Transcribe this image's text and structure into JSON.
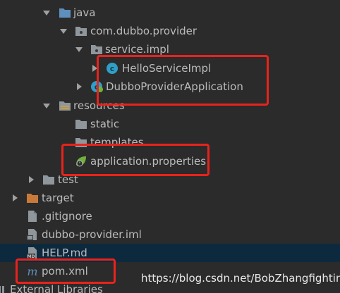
{
  "colors": {
    "background": "#2b2b2b",
    "selected_row": "#0d293e",
    "text": "#bbbbbb",
    "folder_blue": "#5f8fbd",
    "folder_gray": "#8f969c",
    "folder_orange": "#c97a3a",
    "annotation_red": "#e8231c",
    "class_cyan": "#2f9fc8",
    "spring_green": "#6fb23a"
  },
  "tree": {
    "java": "java",
    "package_provider": "com.dubbo.provider",
    "package_service_impl": "service.impl",
    "class_hello": "HelloServiceImpl",
    "class_app": "DubboProviderApplication",
    "folder_resources": "resources",
    "folder_static": "static",
    "folder_templates": "templates",
    "file_app_props": "application.properties",
    "folder_test": "test",
    "folder_target": "target",
    "file_gitignore": ".gitignore",
    "file_iml": "dubbo-provider.iml",
    "file_help": "HELP.md",
    "file_pom": "pom.xml",
    "external_libraries": "External Libraries"
  },
  "icons": {
    "folder": "folder-icon",
    "package": "package-icon",
    "class": "class-icon",
    "spring_class": "spring-boot-class-icon",
    "properties": "spring-properties-icon",
    "file": "file-icon",
    "markdown": "markdown-icon",
    "maven": "maven-icon"
  },
  "watermark": "https://blog.csdn.net/BobZhangfighting"
}
